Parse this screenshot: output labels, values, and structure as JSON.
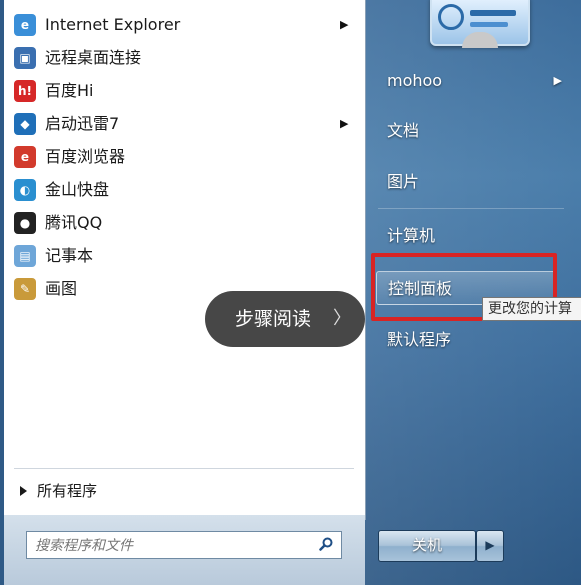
{
  "programs": [
    {
      "label": "Internet Explorer",
      "icon": "internet-explorer-icon",
      "submenu": true,
      "color": "#3a8fd8"
    },
    {
      "label": "远程桌面连接",
      "icon": "remote-desktop-icon",
      "submenu": false,
      "color": "#3a6fb0"
    },
    {
      "label": "百度Hi",
      "icon": "baidu-hi-icon",
      "submenu": false,
      "color": "#d62828"
    },
    {
      "label": "启动迅雷7",
      "icon": "xunlei-icon",
      "submenu": true,
      "color": "#1f6fb8"
    },
    {
      "label": "百度浏览器",
      "icon": "baidu-browser-icon",
      "submenu": false,
      "color": "#d23a2c"
    },
    {
      "label": "金山快盘",
      "icon": "kuaipan-icon",
      "submenu": false,
      "color": "#2a8fd0"
    },
    {
      "label": "腾讯QQ",
      "icon": "qq-icon",
      "submenu": false,
      "color": "#222222"
    },
    {
      "label": "记事本",
      "icon": "notepad-icon",
      "submenu": false,
      "color": "#6ea6d8"
    },
    {
      "label": "画图",
      "icon": "paint-icon",
      "submenu": false,
      "color": "#c99a3a"
    }
  ],
  "all_programs": "所有程序",
  "search": {
    "placeholder": "搜索程序和文件"
  },
  "right_menu": {
    "user": "mohoo",
    "documents": "文档",
    "pictures": "图片",
    "computer": "计算机",
    "control_panel": "控制面板",
    "default_programs": "默认程序"
  },
  "tooltip": "更改您的计算",
  "shutdown": {
    "label": "关机"
  },
  "overlay": {
    "step_read": "步骤阅读"
  },
  "colors": {
    "highlight_box": "#d82424",
    "start_panel": "#3d6d9c"
  }
}
